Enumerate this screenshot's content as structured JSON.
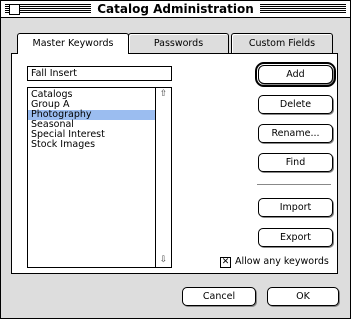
{
  "window": {
    "title": "Catalog Administration"
  },
  "tabs": [
    {
      "label": "Master Keywords",
      "active": true
    },
    {
      "label": "Passwords",
      "active": false
    },
    {
      "label": "Custom Fields",
      "active": false
    }
  ],
  "keyword_field": {
    "value": "Fall Insert"
  },
  "keywords": [
    {
      "label": "Catalogs",
      "selected": false
    },
    {
      "label": "Group A",
      "selected": false
    },
    {
      "label": "Photography",
      "selected": true
    },
    {
      "label": "Seasonal",
      "selected": false
    },
    {
      "label": "Special Interest",
      "selected": false
    },
    {
      "label": "Stock Images",
      "selected": false
    }
  ],
  "buttons": {
    "add": "Add",
    "delete": "Delete",
    "rename": "Rename...",
    "find": "Find",
    "import": "Import",
    "export": "Export",
    "cancel": "Cancel",
    "ok": "OK"
  },
  "allow_keywords": {
    "label": "Allow any keywords",
    "checked": true
  },
  "colors": {
    "selection": "#9bbdf0",
    "window_bg": "#dddddd"
  }
}
